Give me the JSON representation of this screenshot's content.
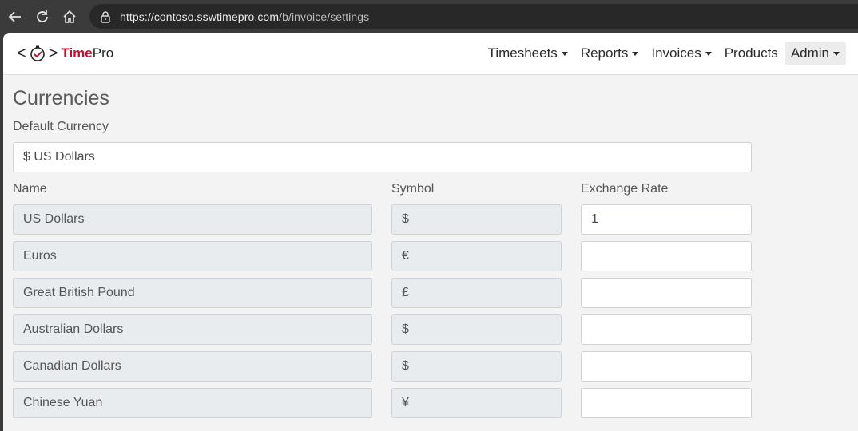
{
  "browser": {
    "url_host": "https://contoso.sswtimepro.com",
    "url_path": "/b/invoice/settings"
  },
  "app": {
    "logo_open": "<",
    "logo_close": ">",
    "logo_time": "Time",
    "logo_pro": "Pro",
    "nav": [
      {
        "label": "Timesheets",
        "dropdown": true
      },
      {
        "label": "Reports",
        "dropdown": true
      },
      {
        "label": "Invoices",
        "dropdown": true
      },
      {
        "label": "Products",
        "dropdown": false
      },
      {
        "label": "Admin",
        "dropdown": true,
        "active": true
      }
    ]
  },
  "currencies": {
    "title": "Currencies",
    "default_label": "Default Currency",
    "default_value": "$ US Dollars",
    "columns": {
      "name": "Name",
      "symbol": "Symbol",
      "rate": "Exchange Rate"
    },
    "rows": [
      {
        "name": "US Dollars",
        "symbol": "$",
        "rate": "1"
      },
      {
        "name": "Euros",
        "symbol": "€",
        "rate": ""
      },
      {
        "name": "Great British Pound",
        "symbol": "£",
        "rate": ""
      },
      {
        "name": "Australian Dollars",
        "symbol": "$",
        "rate": ""
      },
      {
        "name": "Canadian Dollars",
        "symbol": "$",
        "rate": ""
      },
      {
        "name": "Chinese Yuan",
        "symbol": "¥",
        "rate": ""
      }
    ]
  },
  "colors": {
    "brand_red": "#c8102e",
    "readonly_bg": "#e9ecef",
    "page_bg": "#f3f3f3"
  }
}
